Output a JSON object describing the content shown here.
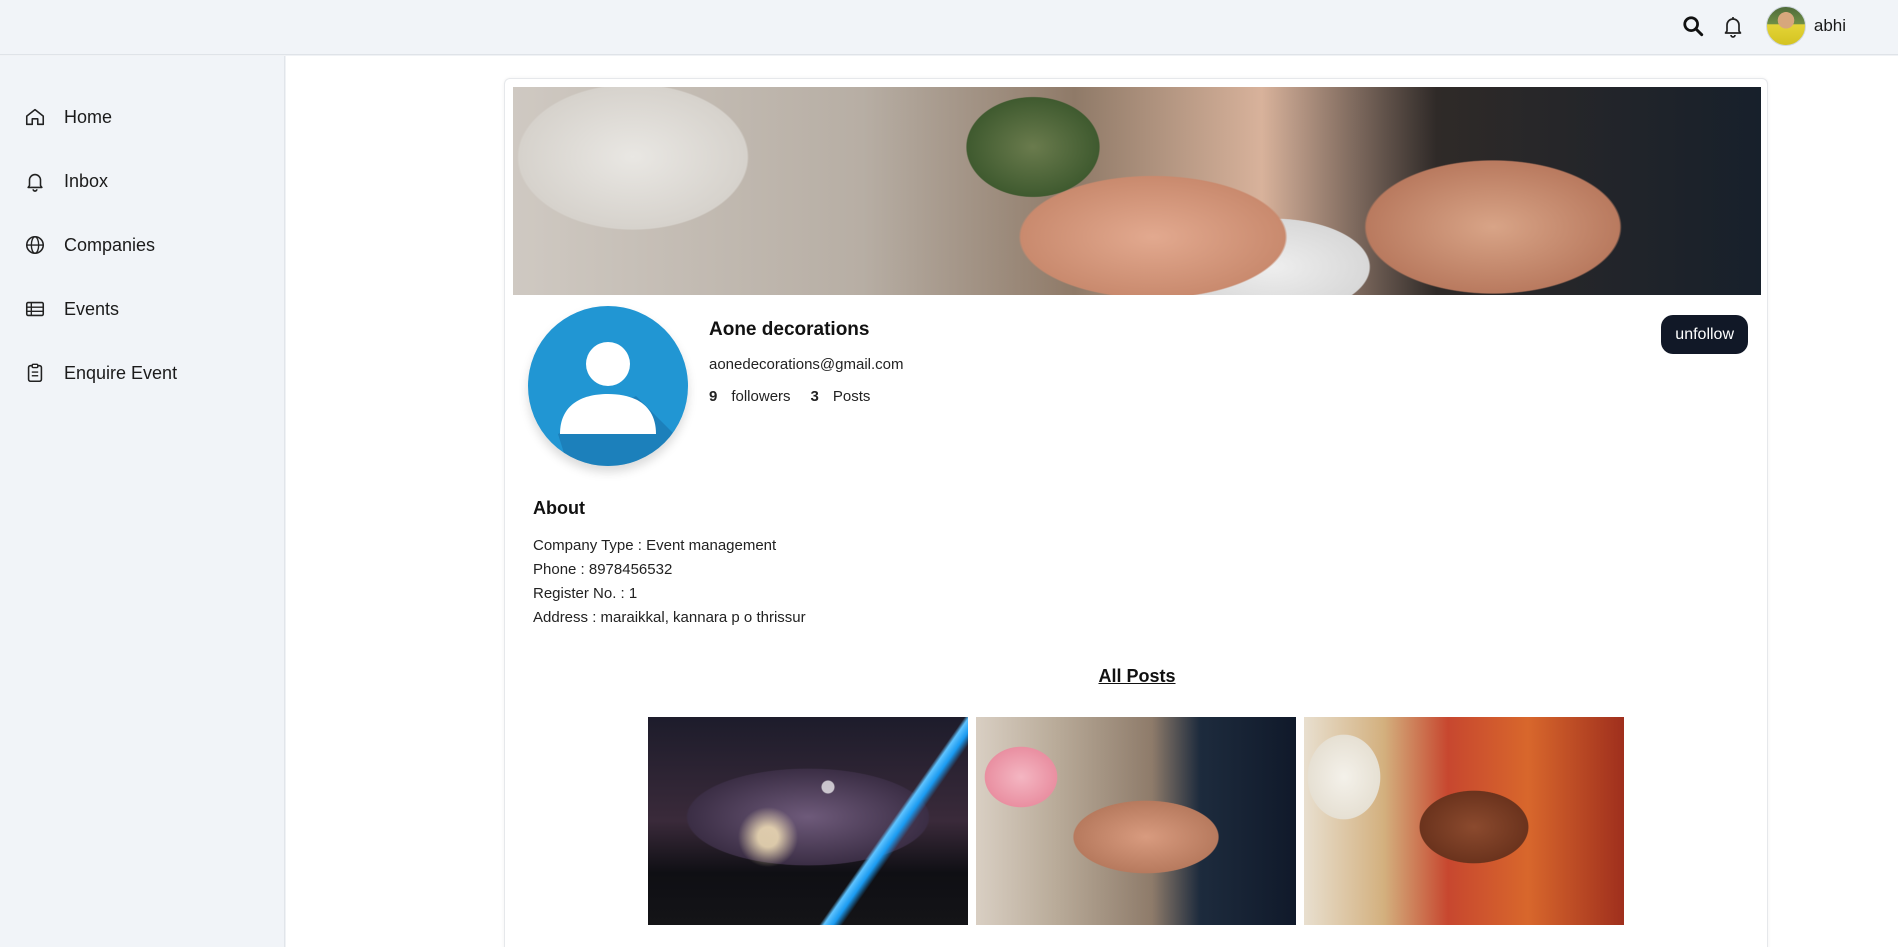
{
  "header": {
    "search_icon": "search-icon",
    "bell_icon": "bell-icon",
    "username": "abhi"
  },
  "sidebar": {
    "items": [
      {
        "label": "Home",
        "icon": "home-icon"
      },
      {
        "label": "Inbox",
        "icon": "bell-icon"
      },
      {
        "label": "Companies",
        "icon": "globe-icon"
      },
      {
        "label": "Events",
        "icon": "list-icon"
      },
      {
        "label": "Enquire Event",
        "icon": "clipboard-icon"
      }
    ]
  },
  "profile": {
    "name": "Aone decorations",
    "email": "aonedecorations@gmail.com",
    "followers_count": "9",
    "followers_label": "followers",
    "posts_count": "3",
    "posts_label": "Posts",
    "unfollow_label": "unfollow",
    "profile_color": "#2196d3"
  },
  "about": {
    "title": "About",
    "company_type": "Company Type : Event management",
    "phone": "Phone : 8978456532",
    "register_no": "Register No. : 1",
    "address": "Address : maraikkal, kannara p o thrissur"
  },
  "posts": {
    "title": "All Posts",
    "items": [
      "concert-photo",
      "wedding-hands-photo",
      "indian-wedding-photo"
    ]
  },
  "colors": {
    "button_bg": "#111827",
    "sidebar_bg": "#f1f4f8"
  }
}
